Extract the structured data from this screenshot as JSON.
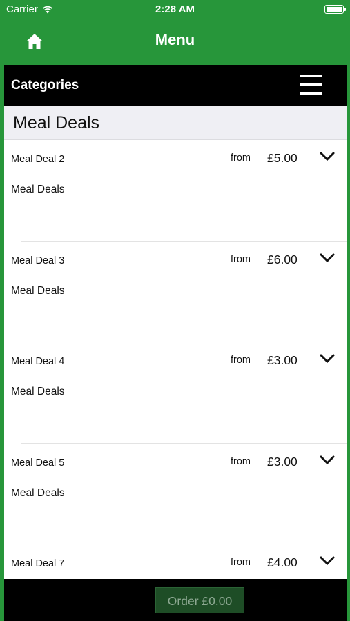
{
  "status_bar": {
    "carrier": "Carrier",
    "time": "2:28 AM",
    "icons": [
      "wifi-icon",
      "battery-icon"
    ]
  },
  "nav": {
    "title": "Menu",
    "home_icon": "home-icon"
  },
  "categories": {
    "label": "Categories",
    "menu_icon": "hamburger-icon"
  },
  "section": {
    "title": "Meal Deals"
  },
  "items": [
    {
      "name": "Meal Deal 2",
      "from": "from",
      "price": "£5.00",
      "description": "Meal Deals"
    },
    {
      "name": "Meal Deal 3",
      "from": "from",
      "price": "£6.00",
      "description": "Meal Deals"
    },
    {
      "name": "Meal Deal 4",
      "from": "from",
      "price": "£3.00",
      "description": "Meal Deals"
    },
    {
      "name": "Meal Deal 5",
      "from": "from",
      "price": "£3.00",
      "description": "Meal Deals"
    },
    {
      "name": "Meal Deal 7",
      "from": "from",
      "price": "£4.00",
      "description": ""
    }
  ],
  "order": {
    "label": "Order £0.00"
  },
  "colors": {
    "brand_green": "#27963a",
    "bar_black": "#000000",
    "order_button": "#1e4d26"
  }
}
